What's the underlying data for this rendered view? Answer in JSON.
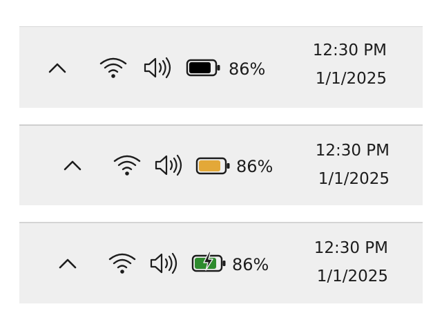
{
  "taskbar_variants": [
    {
      "chevron_icon": "chevron-up-icon",
      "wifi_icon": "wifi-icon",
      "volume_icon": "speaker-volume-icon",
      "battery_icon": "battery-icon",
      "battery_state": "normal",
      "battery_fill_color": "#000000",
      "battery_level": 0.86,
      "battery_percent": "86%",
      "time": "12:30 PM",
      "date": "1/1/2025"
    },
    {
      "chevron_icon": "chevron-up-icon",
      "wifi_icon": "wifi-icon",
      "volume_icon": "speaker-volume-icon",
      "battery_icon": "battery-icon",
      "battery_state": "saver",
      "battery_fill_color": "#E3A838",
      "battery_level": 0.86,
      "battery_percent": "86%",
      "time": "12:30 PM",
      "date": "1/1/2025"
    },
    {
      "chevron_icon": "chevron-up-icon",
      "wifi_icon": "wifi-icon",
      "volume_icon": "speaker-volume-icon",
      "battery_icon": "battery-charging-icon",
      "battery_state": "charging",
      "battery_fill_color": "#2E8B2E",
      "battery_level": 0.86,
      "battery_percent": "86%",
      "time": "12:30 PM",
      "date": "1/1/2025"
    }
  ]
}
